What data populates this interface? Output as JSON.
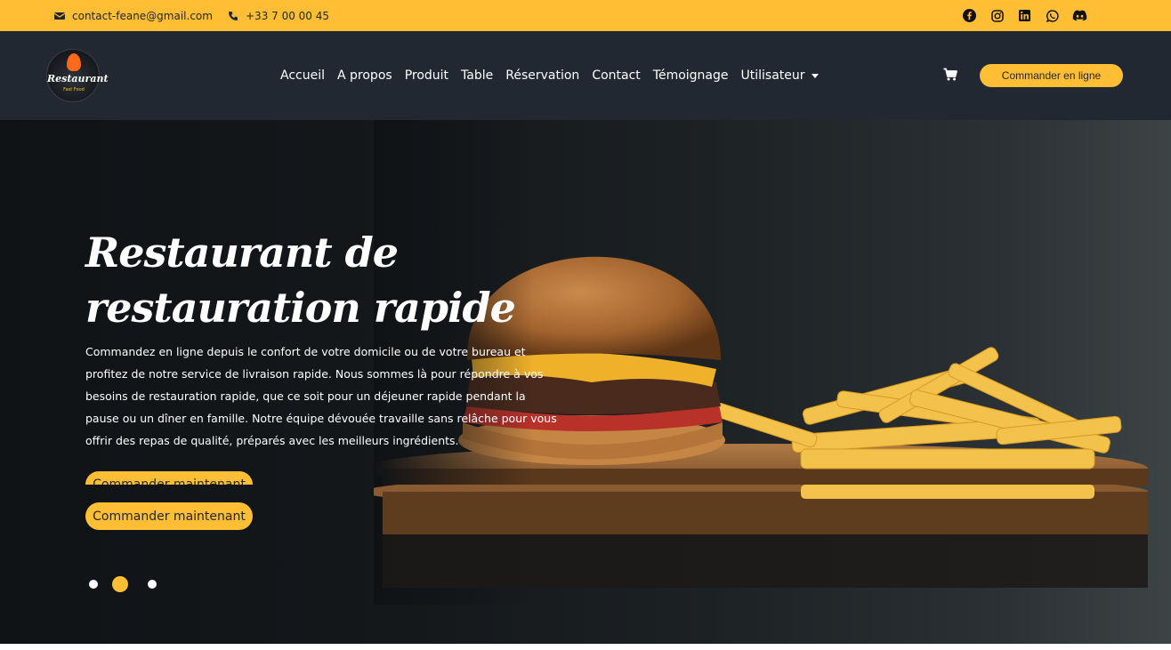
{
  "topbar": {
    "email": "contact-feane@gmail.com",
    "phone": "+33 7 00 00 45",
    "social_icons": [
      "facebook-icon",
      "instagram-icon",
      "linkedin-icon",
      "whatsapp-icon",
      "discord-icon"
    ]
  },
  "header": {
    "logo_word": "Restaurant",
    "logo_sub": "Fast Food",
    "nav": [
      "Accueil",
      "A propos",
      "Produit",
      "Table",
      "Réservation",
      "Contact",
      "Témoignage",
      "Utilisateur"
    ],
    "order_online": "Commander en ligne"
  },
  "hero": {
    "title": "Restaurant de restauration rapide",
    "text": "Commandez en ligne depuis le confort de votre domicile ou de votre bureau et profitez de notre service de livraison rapide. Nous sommes là pour répondre à vos besoins de restauration rapide, que ce soit pour un déjeuner rapide pendant la pause ou un dîner en famille. Notre équipe dévouée travaille sans relâche pour vous offrir des repas de qualité, préparés avec les meilleurs ingrédients.",
    "cta_ghost": "Commander maintenant",
    "cta": "Commander maintenant",
    "slides": 3,
    "active_slide": 2
  },
  "colors": {
    "accent": "#ffbe33",
    "dark": "#222831"
  }
}
